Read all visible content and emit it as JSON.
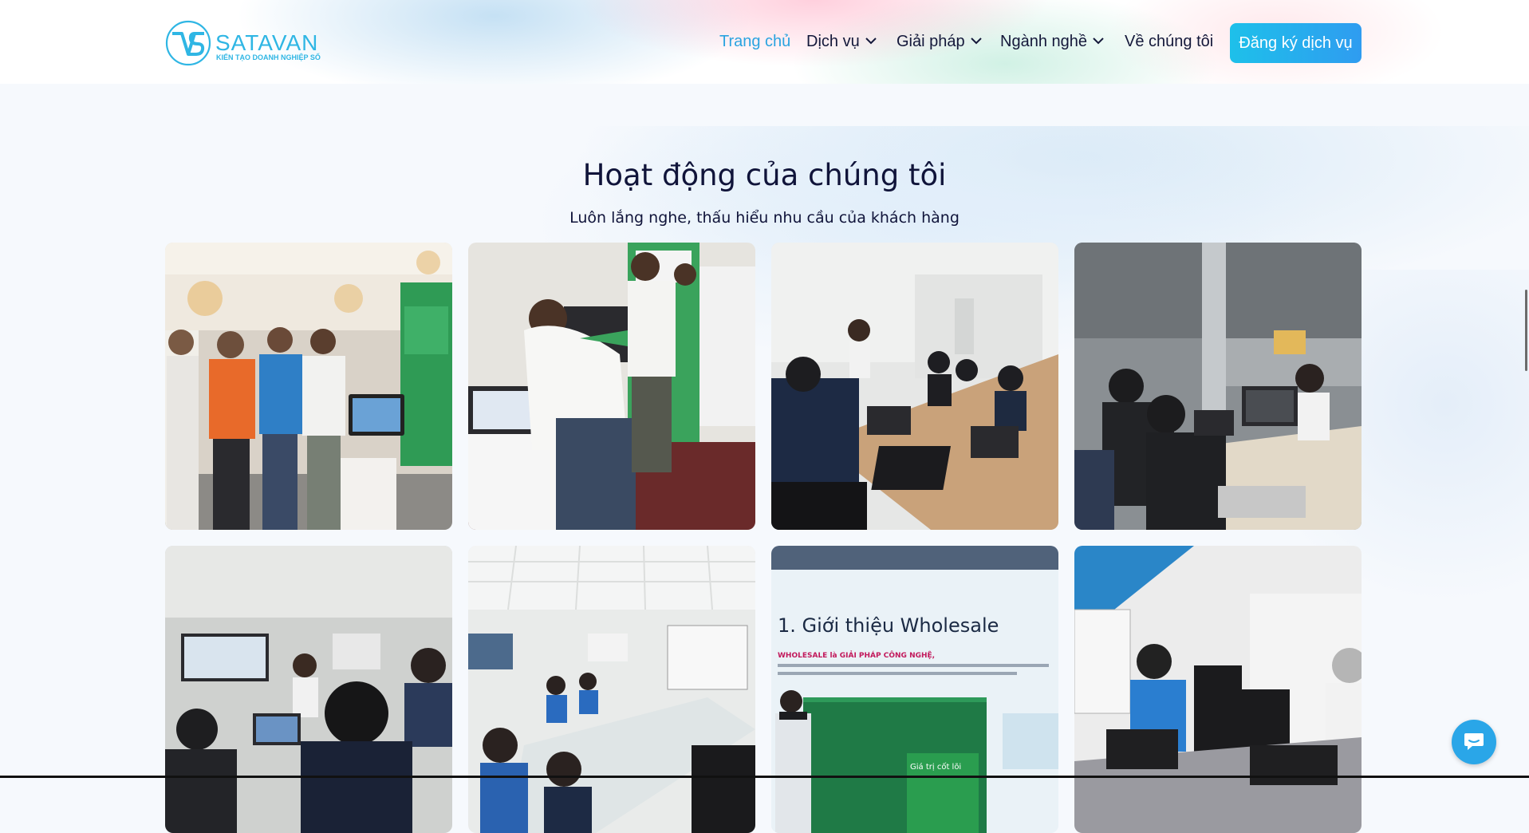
{
  "header": {
    "logo": {
      "name": "SATAVAN",
      "tagline": "KIẾN TẠO DOANH NGHIỆP SỐ",
      "color": "#2fb6e4"
    },
    "nav": [
      {
        "label": "Trang chủ",
        "active": true,
        "has_dropdown": false
      },
      {
        "label": "Dịch vụ",
        "active": false,
        "has_dropdown": true
      },
      {
        "label": "Giải pháp",
        "active": false,
        "has_dropdown": true
      },
      {
        "label": "Ngành nghề",
        "active": false,
        "has_dropdown": true
      },
      {
        "label": "Về chúng tôi",
        "active": false,
        "has_dropdown": false
      }
    ],
    "cta_label": "Đăng ký dịch vụ",
    "accent_color": "#2aa3e0"
  },
  "activities": {
    "title": "Hoạt động của chúng tôi",
    "subtitle": "Luôn lắng nghe, thấu hiểu nhu cầu của khách hàng",
    "photos": [
      {
        "scene": "expo-booth-group"
      },
      {
        "scene": "expo-laptop-demo"
      },
      {
        "scene": "training-classroom"
      },
      {
        "scene": "office-developers"
      },
      {
        "scene": "glass-meeting-room"
      },
      {
        "scene": "conference-table"
      },
      {
        "scene": "presentation-screen",
        "slide_title": "1. Giới thiệu Wholesale",
        "slide_highlight": "WHOLESALE là GIẢI PHÁP CÔNG NGHỆ,",
        "slide_badge": "Giá trị cốt lõi"
      },
      {
        "scene": "office-workshop"
      }
    ]
  },
  "chat": {
    "icon": "chat-bubble-icon"
  }
}
